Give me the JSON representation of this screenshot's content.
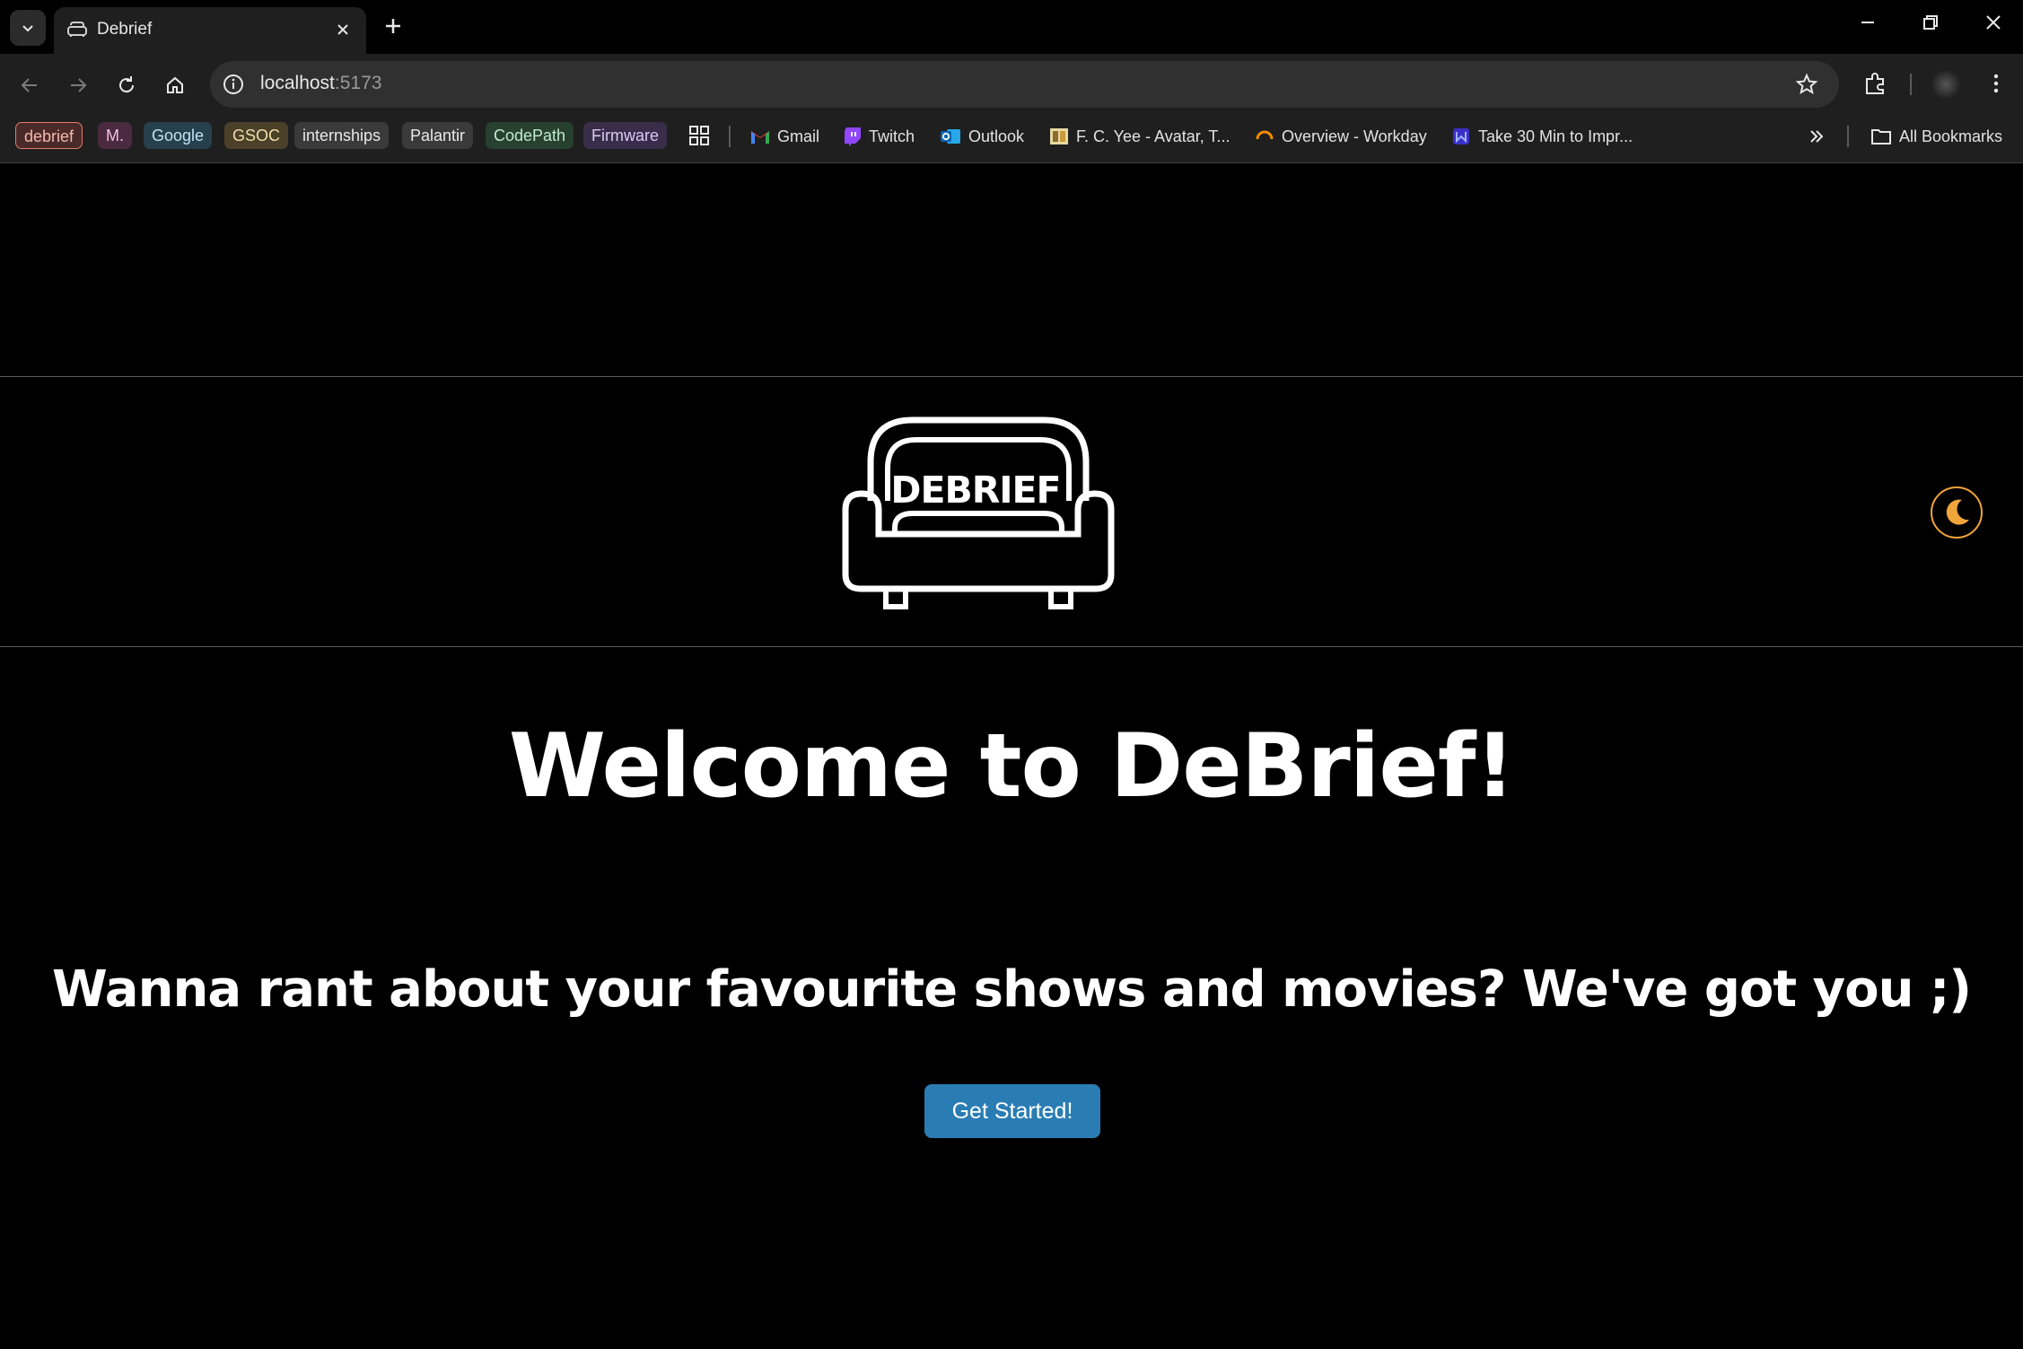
{
  "browser": {
    "tab": {
      "title": "Debrief",
      "favicon": "sofa-icon"
    },
    "url": {
      "host": "localhost",
      "port": ":5173"
    },
    "bookmarks": {
      "chips": [
        {
          "label": "debrief",
          "bg": "#4a2a28",
          "fg": "#f3b7ae",
          "border": "#e07a6c"
        },
        {
          "label": "M.",
          "bg": "#4a2a3f",
          "fg": "#f0c2e0"
        },
        {
          "label": "Google",
          "bg": "#27404d",
          "fg": "#bfe3f5"
        },
        {
          "label": "GSOC",
          "bg": "#4a4128",
          "fg": "#f2ddaa"
        },
        {
          "label": "internships",
          "bg": "#3a3a3a",
          "fg": "#e8e8e8"
        },
        {
          "label": "Palantir",
          "bg": "#3a3a3a",
          "fg": "#e8e8e8"
        },
        {
          "label": "CodePath",
          "bg": "#27402f",
          "fg": "#bfeccc"
        },
        {
          "label": "Firmware",
          "bg": "#3a2d4a",
          "fg": "#dcc8f3"
        }
      ],
      "links": [
        {
          "label": "Gmail",
          "icon": "gmail-icon"
        },
        {
          "label": "Twitch",
          "icon": "twitch-icon"
        },
        {
          "label": "Outlook",
          "icon": "outlook-icon"
        },
        {
          "label": "F. C. Yee - Avatar, T...",
          "icon": "book-icon"
        },
        {
          "label": "Overview - Workday",
          "icon": "workday-icon"
        },
        {
          "label": "Take 30 Min to Impr...",
          "icon": "site-icon"
        }
      ],
      "all_bookmarks": "All Bookmarks"
    }
  },
  "page": {
    "logo_text": "DEBRIEF",
    "title": "Welcome to DeBrief!",
    "subtitle": "Wanna rant about your favourite shows and movies? We've got you ;)",
    "cta_label": "Get Started!",
    "theme_toggle_icon": "moon-icon",
    "colors": {
      "background": "#000000",
      "button": "#2a7db3",
      "moon": "#f0a53a"
    }
  }
}
